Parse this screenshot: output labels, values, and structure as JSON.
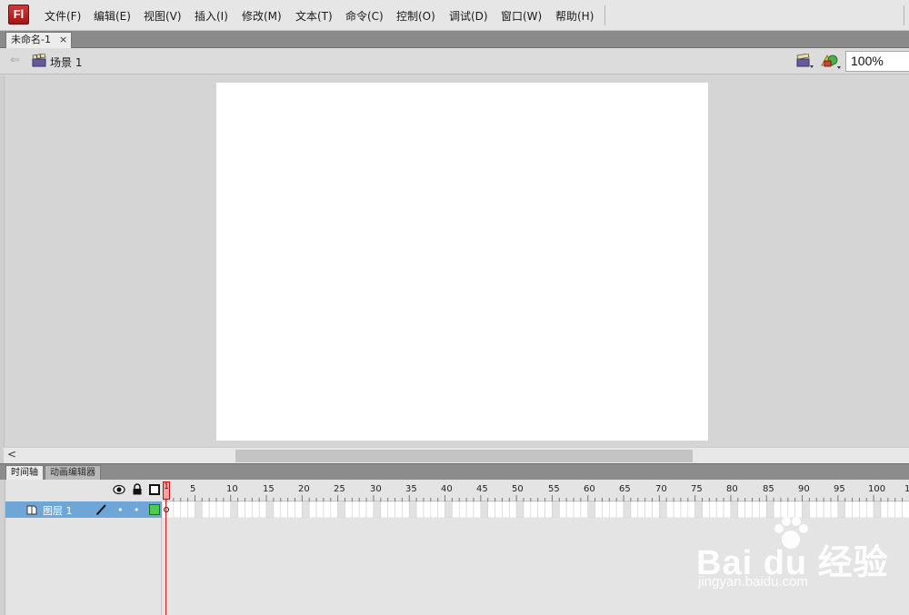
{
  "app": {
    "logo": "Fl"
  },
  "menu": {
    "items": [
      {
        "label": "文件(F)"
      },
      {
        "label": "编辑(E)"
      },
      {
        "label": "视图(V)"
      },
      {
        "label": "插入(I)"
      },
      {
        "label": "修改(M)"
      },
      {
        "label": "文本(T)"
      },
      {
        "label": "命令(C)"
      },
      {
        "label": "控制(O)"
      },
      {
        "label": "调试(D)"
      },
      {
        "label": "窗口(W)"
      },
      {
        "label": "帮助(H)"
      }
    ]
  },
  "document": {
    "tab_label": "未命名-1",
    "close_glyph": "×"
  },
  "editbar": {
    "back_glyph": "⇐",
    "scene_label": "场景 1",
    "zoom": "100%"
  },
  "scrollbar": {
    "left_glyph": "<"
  },
  "panels": {
    "tabs": [
      {
        "label": "时间轴"
      },
      {
        "label": "动画编辑器"
      }
    ]
  },
  "timeline": {
    "layer_name": "图层 1",
    "layer_dot": "•",
    "playhead_frame": "1",
    "ruler": [
      "5",
      "10",
      "15",
      "20",
      "25",
      "30",
      "35",
      "40",
      "45",
      "50",
      "55",
      "60",
      "65",
      "70",
      "75",
      "80",
      "85",
      "90",
      "95",
      "100",
      "1"
    ]
  },
  "watermark": {
    "brand": "Bai du 经验",
    "url": "jingyan.baidu.com"
  },
  "colors": {
    "stage": "#ffffff",
    "layer_selected": "#6ea6d8",
    "layer_color": "#4ccd4c",
    "playhead": "#e02020"
  }
}
